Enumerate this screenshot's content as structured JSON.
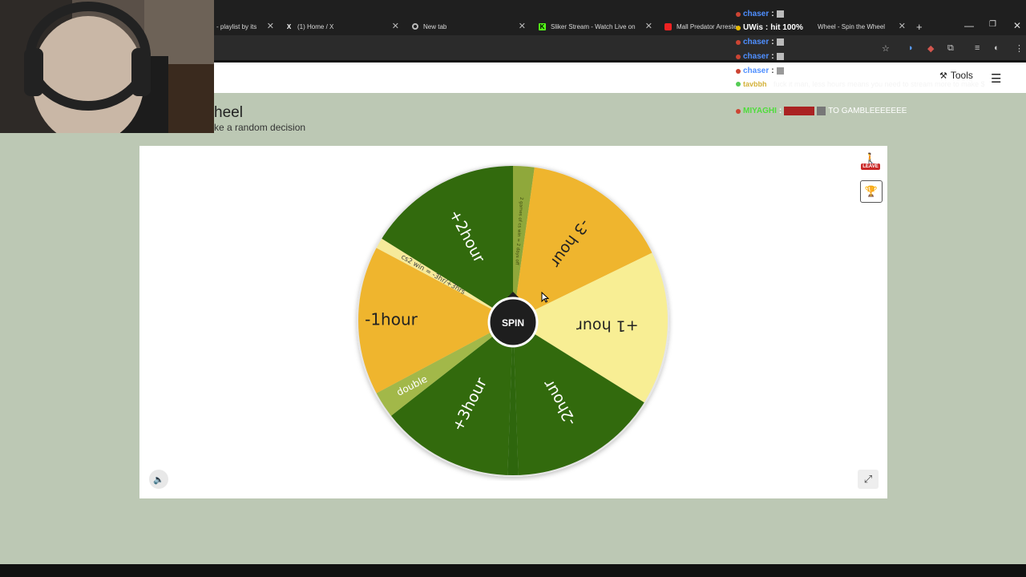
{
  "browser": {
    "tabs": [
      {
        "label": "- playlist by its",
        "icon": "music-icon"
      },
      {
        "label": "(1) Home / X",
        "icon": "x-logo-icon"
      },
      {
        "label": "New tab",
        "icon": "chrome-icon"
      },
      {
        "label": "Sliker Stream - Watch Live on K",
        "icon": "kick-logo-icon"
      },
      {
        "label": "Mall Predator Arreste",
        "icon": "youtube-icon"
      },
      {
        "label": "Wheel - Spin the Wheel",
        "icon": "wheel-icon"
      }
    ],
    "new_tab": "+"
  },
  "site": {
    "tools_label": "Tools",
    "title": "heel",
    "subtitle": "ke a random decision"
  },
  "wheel": {
    "center_label": "SPIN",
    "segments": [
      {
        "label": "2 games of cs win = 2 days off",
        "color": "#8fa83a"
      },
      {
        "label": "-3 hour",
        "color": "#efb52d"
      },
      {
        "label": "+1 hour",
        "color": "#f8ee94"
      },
      {
        "label": "-2hour",
        "color": "#316a0e"
      },
      {
        "label": "",
        "color": "#2e6610"
      },
      {
        "label": "+3hour",
        "color": "#316a0e"
      },
      {
        "label": "double",
        "color": "#a2b848"
      },
      {
        "label": "-1hour",
        "color": "#efb52d"
      },
      {
        "label": "cs2 win = -3hr/+3hrs",
        "color": "#f6ea9a"
      },
      {
        "label": "+2hour",
        "color": "#316a0e"
      }
    ]
  },
  "leave_label": "LEAVE",
  "chat": [
    {
      "user": "chaser",
      "text": "",
      "color": "#4f8fff"
    },
    {
      "user": "UWis",
      "text": "hit 100%",
      "color": "#ffffff"
    },
    {
      "user": "chaser",
      "text": "",
      "color": "#4f8fff"
    },
    {
      "user": "chaser",
      "text": "",
      "color": "#4f8fff"
    },
    {
      "user": "chaser",
      "text": "",
      "color": "#4f8fff"
    },
    {
      "user": "tavbbh",
      "text": "fuck it man, less hours means you need to stream more to make $",
      "color": "#d4b23a"
    },
    {
      "user": "MIYAGHI",
      "text": "TO GAMBLEEEEEEE",
      "color": "#4fdc3c"
    }
  ]
}
